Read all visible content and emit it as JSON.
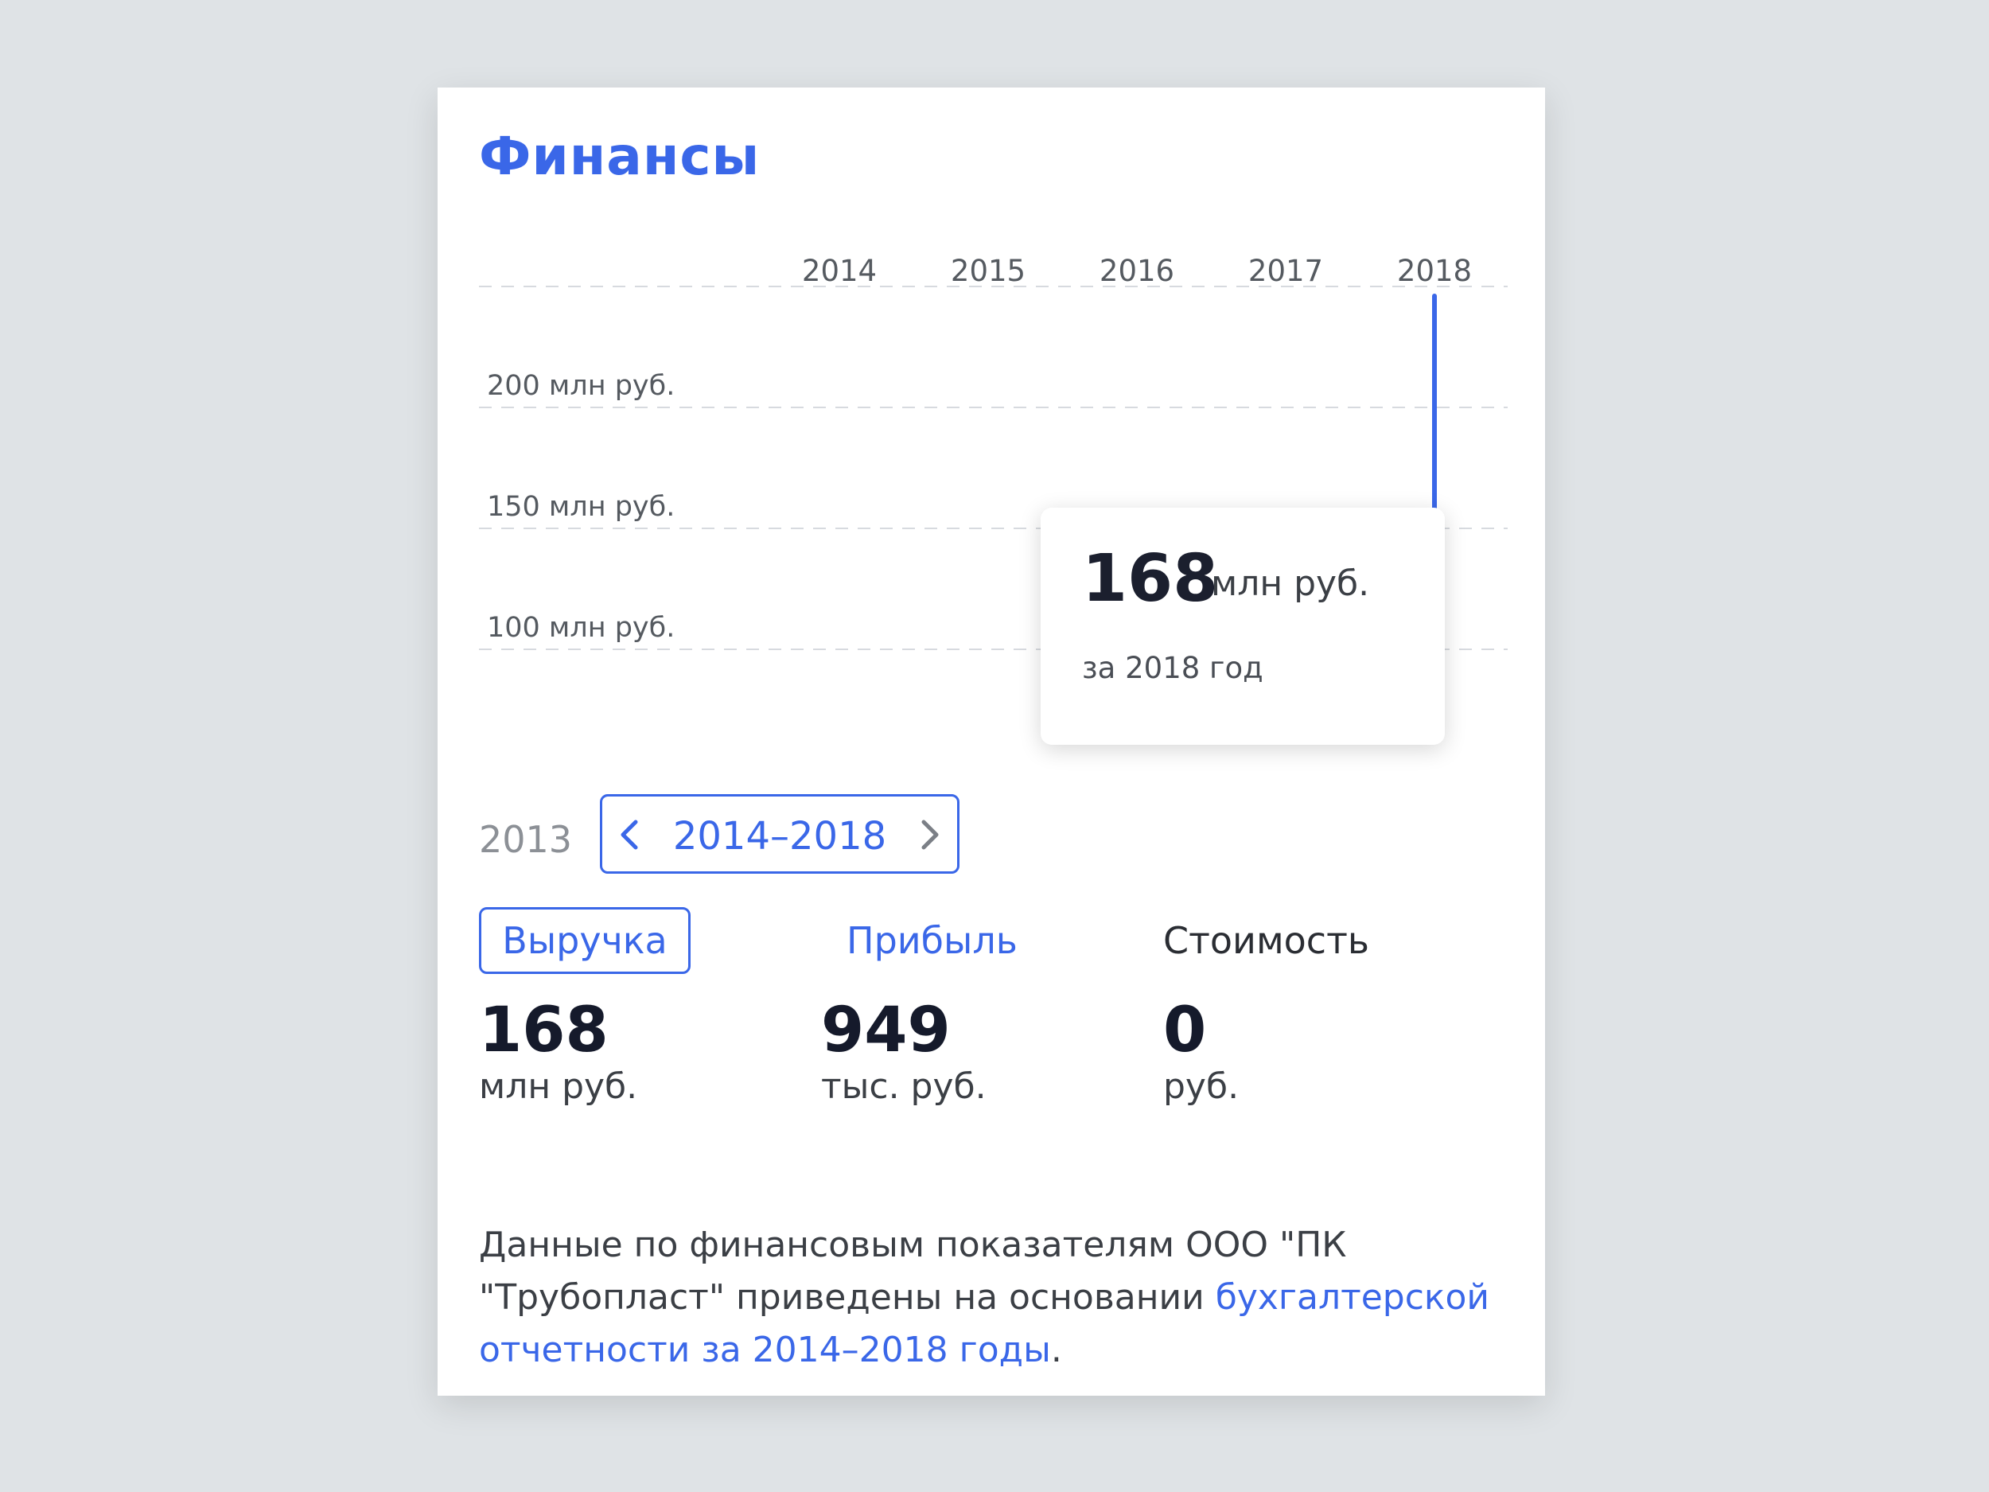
{
  "card": {
    "title": "Финансы"
  },
  "chart_data": {
    "type": "line",
    "x": [
      "2014",
      "2015",
      "2016",
      "2017",
      "2018"
    ],
    "y_tick_labels": [
      "200 млн руб.",
      "150 млн руб.",
      "100 млн руб."
    ],
    "y_ticks": [
      200,
      150,
      100
    ],
    "series": [
      {
        "values": [
          null,
          null,
          null,
          null,
          168
        ]
      }
    ],
    "selected_year": "2018",
    "selected_value": 168,
    "grid": true
  },
  "tooltip": {
    "value": "168",
    "unit": "млн руб.",
    "period": "за 2018 год"
  },
  "period_nav": {
    "previous_year": "2013",
    "range_label": "2014–2018"
  },
  "tabs": [
    {
      "label": "Выручка",
      "active": true
    },
    {
      "label": "Прибыль",
      "active": false
    },
    {
      "label": "Стоимость",
      "active": false
    }
  ],
  "metrics": [
    {
      "value": "168",
      "unit": "млн руб."
    },
    {
      "value": "949",
      "unit": "тыс. руб."
    },
    {
      "value": "0",
      "unit": "руб."
    }
  ],
  "note": {
    "text": "Данные по финансовым показателям ООО \"ПК \"Трубопласт\" приведены на основании ",
    "link": "бухгалтерской отчетности за 2014–2018 годы",
    "end": "."
  },
  "colors": {
    "accent": "#3a67e8",
    "text_dark": "#151a2b",
    "grid": "#d7dadf"
  }
}
